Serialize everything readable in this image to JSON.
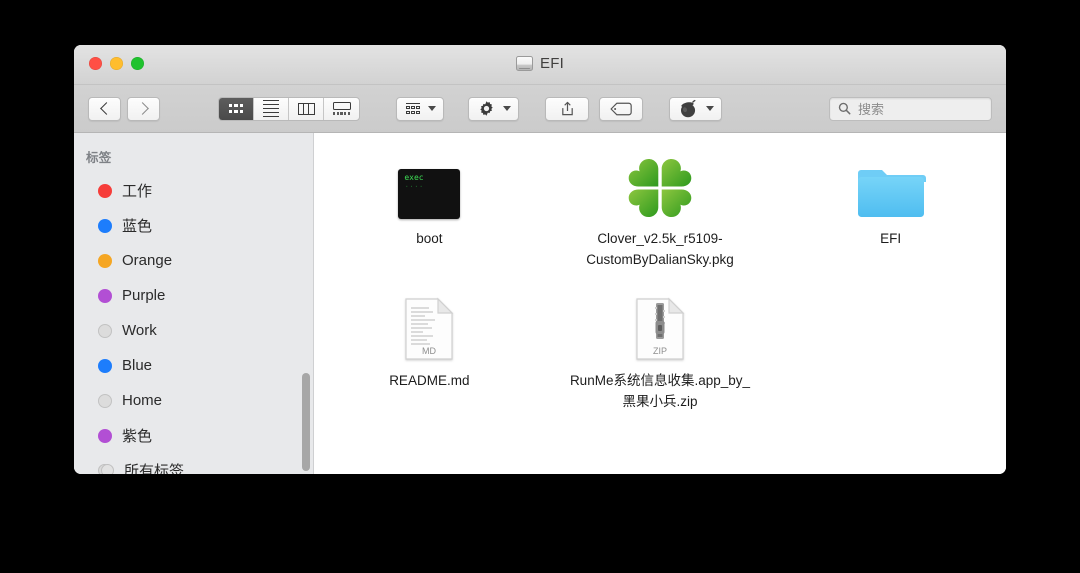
{
  "window": {
    "title": "EFI",
    "title_icon": "disk-icon",
    "traffic_lights": [
      {
        "name": "close",
        "color": "#ff4f45"
      },
      {
        "name": "minimize",
        "color": "#ffbd2e"
      },
      {
        "name": "zoom",
        "color": "#1fc22e"
      }
    ]
  },
  "toolbar": {
    "back_label": "‹",
    "forward_label": "›",
    "view_modes": [
      {
        "name": "icon-view",
        "selected": true
      },
      {
        "name": "list-view",
        "selected": false
      },
      {
        "name": "column-view",
        "selected": false
      },
      {
        "name": "coverflow-view",
        "selected": false
      }
    ],
    "arrange_button": "arrange-icon",
    "action_button": "gear-icon",
    "share_button": "share-icon",
    "tag_button": "tag-icon",
    "extension_button": "acorn-icon",
    "search": {
      "placeholder": "搜索",
      "value": ""
    }
  },
  "sidebar": {
    "header": "标签",
    "items": [
      {
        "label": "工作",
        "color": "#f63d3a",
        "kind": "color"
      },
      {
        "label": "蓝色",
        "color": "#1d7dfc",
        "kind": "color"
      },
      {
        "label": "Orange",
        "color": "#f5a623",
        "kind": "color"
      },
      {
        "label": "Purple",
        "color": "#b24fd4",
        "kind": "color"
      },
      {
        "label": "Work",
        "color": "",
        "kind": "none"
      },
      {
        "label": "Blue",
        "color": "#1d7dfc",
        "kind": "color"
      },
      {
        "label": "Home",
        "color": "",
        "kind": "none"
      },
      {
        "label": "紫色",
        "color": "#b24fd4",
        "kind": "color"
      },
      {
        "label": "所有标签...",
        "color": "",
        "kind": "all"
      }
    ]
  },
  "content": {
    "items": [
      {
        "name": "boot",
        "icon": "unix-executable-icon",
        "icon_text": "exec"
      },
      {
        "name": "Clover_v2.5k_r5109-CustomByDalianSky.pkg",
        "icon": "clover-package-icon"
      },
      {
        "name": "EFI",
        "icon": "folder-icon"
      },
      {
        "name": "README.md",
        "icon": "markdown-document-icon",
        "icon_badge": "MD"
      },
      {
        "name": "RunMe系统信息收集.app_by_黑果小兵.zip",
        "icon": "zip-archive-icon",
        "icon_badge": "ZIP"
      }
    ]
  },
  "colors": {
    "window_bg": "#ffffff",
    "sidebar_bg": "#e8e9eb",
    "toolbar_bg": "#cfcfcf",
    "folder_blue": "#5ac8f5",
    "clover_green": "#4fae2a"
  }
}
